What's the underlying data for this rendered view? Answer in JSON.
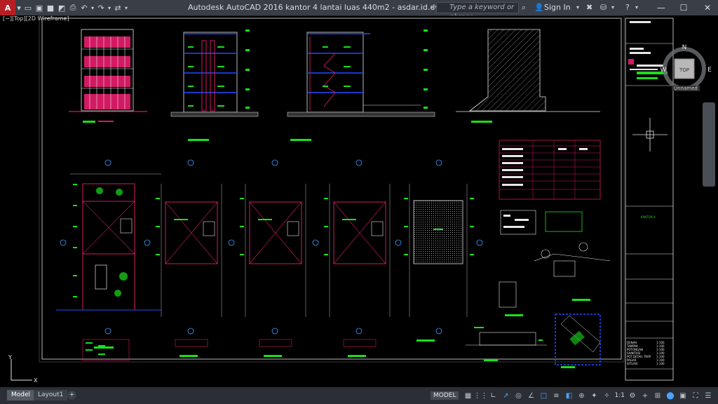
{
  "titlebar": {
    "app_menu": "A",
    "title": "Autodesk AutoCAD 2016      kantor 4 lantai luas 440m2 - asdar.id.dwg",
    "search_placeholder": "Type a keyword or phrase",
    "sign_in": "Sign In",
    "qat_icons": [
      "new-icon",
      "open-icon",
      "save-icon",
      "saveas-icon",
      "print-icon",
      "undo-icon",
      "redo-icon",
      "share-icon"
    ]
  },
  "viewport": {
    "label": "[−][Top][2D Wireframe]",
    "viewcube": {
      "top": "TOP",
      "north": "N",
      "south": "S",
      "east": "E",
      "west": "W"
    },
    "wcs": "Unnamed",
    "ucs": {
      "x": "X",
      "y": "Y"
    }
  },
  "drawing": {
    "title_block": {
      "project": "KANTOR 4"
    },
    "scale_table": {
      "rows": [
        [
          "DENAH",
          "1:100"
        ],
        [
          "TAMPAK",
          "1:100"
        ],
        [
          "POTONGAN",
          "1:100"
        ],
        [
          "SAINITASI",
          "1:100"
        ],
        [
          "POT.DETAIL TRAP",
          "1:100"
        ],
        [
          "PAGAR",
          "1:100"
        ],
        [
          "SITUASI",
          "1:100"
        ]
      ]
    }
  },
  "tabs": {
    "model": "Model",
    "layout1": "Layout1",
    "add": "+"
  },
  "statusbar": {
    "model": "MODEL",
    "scale": "1:1"
  },
  "colors": {
    "accent": "#b51f24",
    "green": "#19e019",
    "magenta": "#d21a62",
    "white": "#e6e6e6",
    "blue": "#1f4cff"
  }
}
